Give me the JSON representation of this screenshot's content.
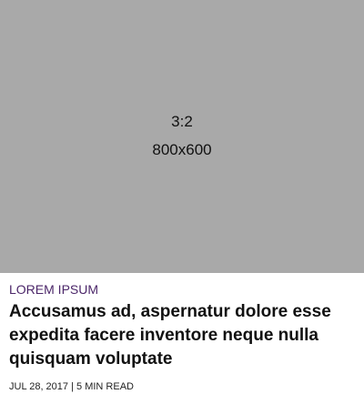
{
  "card": {
    "image": {
      "ratio_text": "3:2",
      "size_text": "800x600"
    },
    "category": "LOREM IPSUM",
    "headline": "Accusamus ad, aspernatur dolore esse expedita facere inventore neque nulla quisquam voluptate",
    "meta": {
      "date": "JUL 28, 2017",
      "separator": "|",
      "read_time": "5 MIN READ"
    }
  },
  "colors": {
    "placeholder_bg": "#a9a9a9",
    "category_accent": "#4b2669",
    "headline_text": "#111111"
  }
}
